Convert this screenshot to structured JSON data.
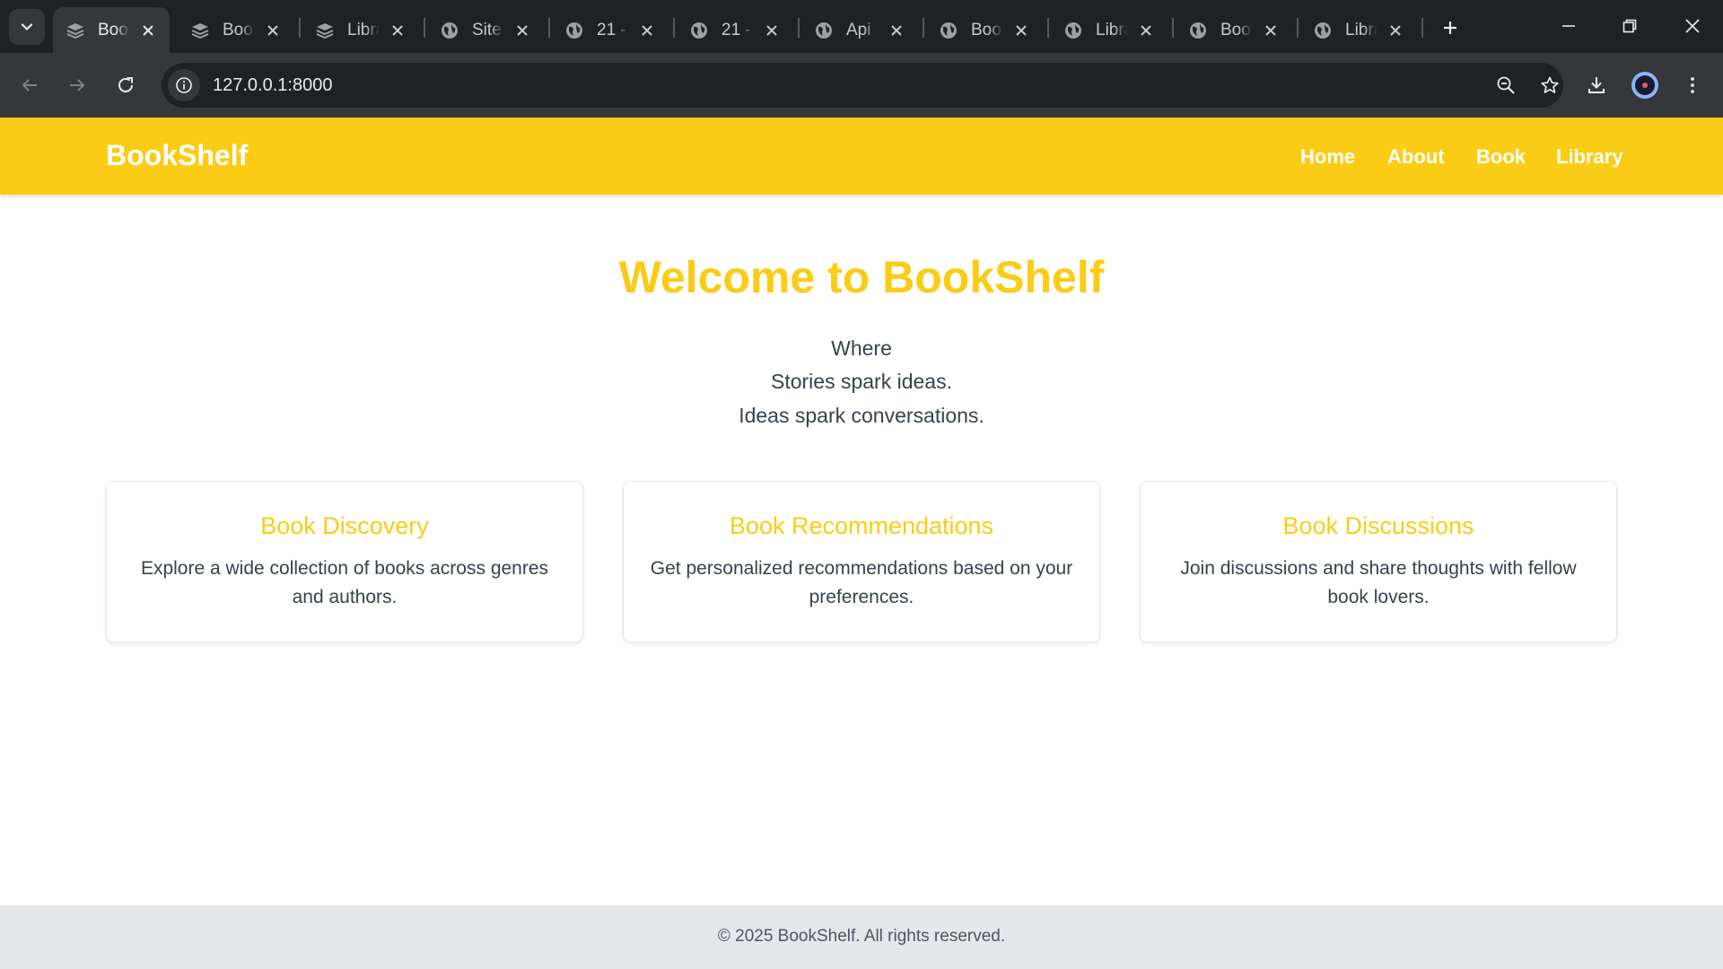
{
  "browser": {
    "tabs": [
      {
        "title": "BookShelf",
        "icon": "stack-icon",
        "active": true
      },
      {
        "title": "BookShelf",
        "icon": "stack-icon",
        "active": false
      },
      {
        "title": "Library",
        "icon": "stack-icon",
        "active": false
      },
      {
        "title": "Site",
        "icon": "globe-icon",
        "active": false
      },
      {
        "title": "21 -",
        "icon": "globe-icon",
        "active": false
      },
      {
        "title": "21 -",
        "icon": "globe-icon",
        "active": false
      },
      {
        "title": "Api",
        "icon": "globe-icon",
        "active": false
      },
      {
        "title": "Book",
        "icon": "globe-icon",
        "active": false
      },
      {
        "title": "Library",
        "icon": "globe-icon",
        "active": false
      },
      {
        "title": "Book",
        "icon": "globe-icon",
        "active": false
      },
      {
        "title": "Library",
        "icon": "globe-icon",
        "active": false
      }
    ],
    "url": "127.0.0.1:8000"
  },
  "site": {
    "brand": "BookShelf",
    "nav": [
      "Home",
      "About",
      "Book",
      "Library"
    ],
    "hero": {
      "title": "Welcome to BookShelf",
      "lines": [
        "Where",
        "Stories spark ideas.",
        "Ideas spark conversations."
      ]
    },
    "features": [
      {
        "title": "Book Discovery",
        "desc": "Explore a wide collection of books across genres and authors."
      },
      {
        "title": "Book Recommendations",
        "desc": "Get personalized recommendations based on your preferences."
      },
      {
        "title": "Book Discussions",
        "desc": "Join discussions and share thoughts with fellow book lovers."
      }
    ],
    "footer": "© 2025 BookShelf. All rights reserved."
  },
  "colors": {
    "accent": "#facc15",
    "chrome_dark": "#1f2125",
    "chrome_toolbar": "#35373b",
    "footer_bg": "#e5e7eb",
    "body_text": "#374151"
  }
}
